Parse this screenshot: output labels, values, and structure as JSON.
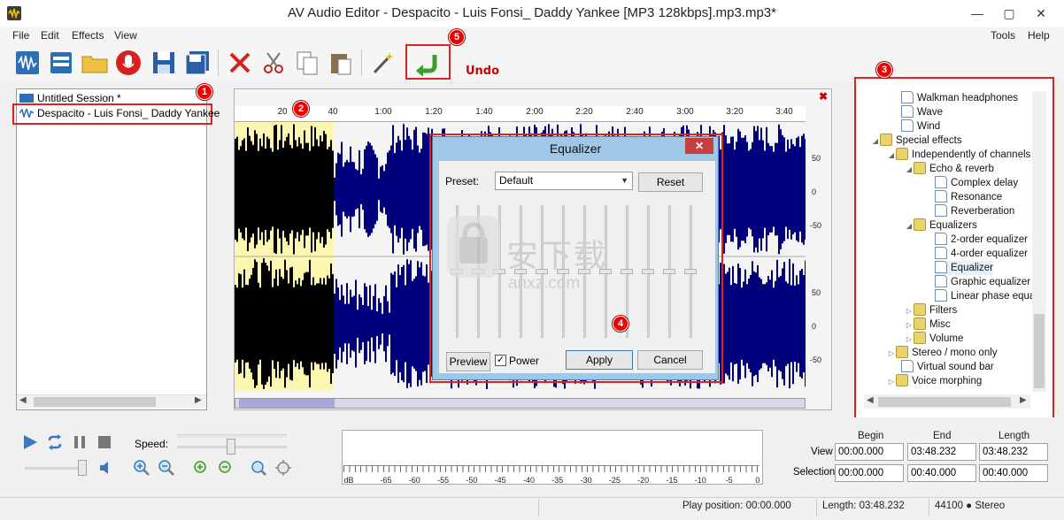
{
  "window": {
    "title": "AV Audio Editor - Despacito - Luis Fonsi_ Daddy Yankee [MP3 128kbps].mp3.mp3*"
  },
  "menu": {
    "file": "File",
    "edit": "Edit",
    "effects": "Effects",
    "view": "View",
    "tools": "Tools",
    "help": "Help"
  },
  "toolbar": {
    "undo_label": "Undo"
  },
  "badges": [
    "1",
    "2",
    "3",
    "4",
    "5"
  ],
  "sessions": {
    "session": "Untitled Session *",
    "track": "Despacito - Luis Fonsi_ Daddy Yankee"
  },
  "timeline": {
    "ticks": [
      "20",
      "40",
      "1:00",
      "1:20",
      "1:40",
      "2:00",
      "2:20",
      "2:40",
      "3:00",
      "3:20",
      "3:40"
    ]
  },
  "db_scale": [
    "50",
    "0",
    "-50",
    "50",
    "0",
    "-50"
  ],
  "tree": {
    "walkman": "Walkman headphones",
    "wave": "Wave",
    "wind": "Wind",
    "special": "Special effects",
    "independent": "Independently of channels",
    "echo": "Echo & reverb",
    "complex": "Complex delay",
    "resonance": "Resonance",
    "reverb": "Reverberation",
    "equalizers": "Equalizers",
    "eq2": "2-order equalizer",
    "eq4": "4-order equalizer",
    "equalizer": "Equalizer",
    "graphic": "Graphic equalizer",
    "linear": "Linear phase equal",
    "filters": "Filters",
    "misc": "Misc",
    "volume": "Volume",
    "stereo": "Stereo / mono only",
    "virtual": "Virtual sound bar",
    "voice": "Voice morphing"
  },
  "equalizer": {
    "title": "Equalizer",
    "preset_label": "Preset:",
    "preset_value": "Default",
    "reset": "Reset",
    "preview": "Preview",
    "power": "Power",
    "apply": "Apply",
    "cancel": "Cancel"
  },
  "watermark": {
    "text": "安下载",
    "domain": "anxz.com"
  },
  "transport": {
    "speed_label": "Speed:"
  },
  "meter": {
    "labels": [
      "dB",
      "-65",
      "-60",
      "-55",
      "-50",
      "-45",
      "-40",
      "-35",
      "-30",
      "-25",
      "-20",
      "-15",
      "-10",
      "-5",
      "0"
    ]
  },
  "range": {
    "begin_hdr": "Begin",
    "end_hdr": "End",
    "length_hdr": "Length",
    "view_label": "View",
    "selection_label": "Selection",
    "view_begin": "00:00.000",
    "view_end": "03:48.232",
    "view_length": "03:48.232",
    "sel_begin": "00:00.000",
    "sel_end": "00:40.000",
    "sel_length": "00:40.000"
  },
  "status": {
    "play_position": "Play position: 00:00.000",
    "length": "Length: 03:48.232",
    "format": "44100 ● Stereo"
  },
  "colors": {
    "waveform": "#00007c",
    "selection_bg": "#fdf6b0",
    "selection_wave": "#000000",
    "accent_red": "#d22222"
  }
}
